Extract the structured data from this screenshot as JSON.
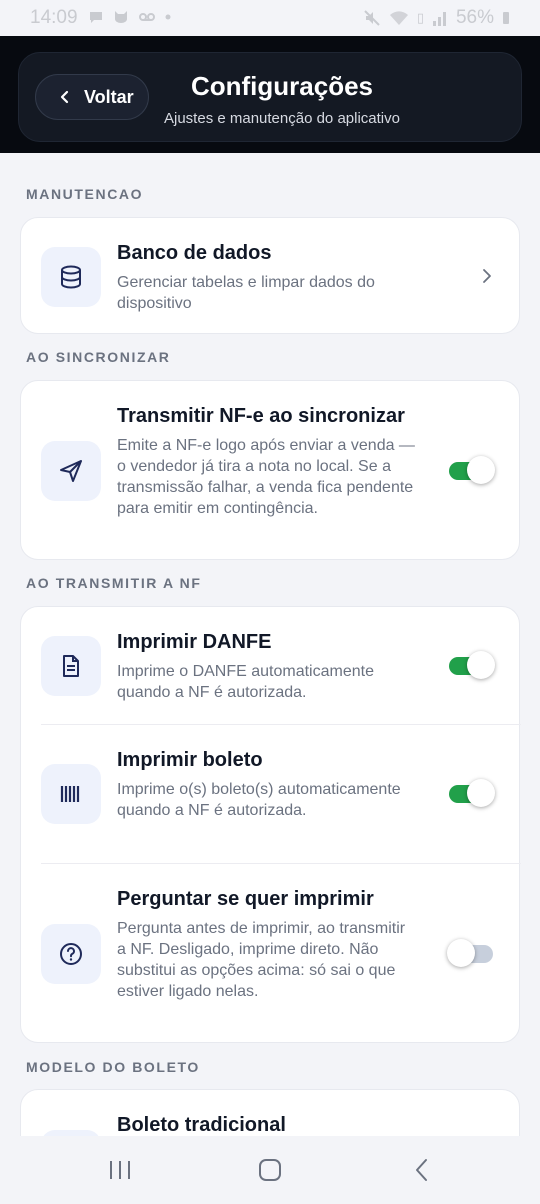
{
  "status_bar": {
    "time": "14:09",
    "left_icons": [
      "chat-bubble-icon",
      "cat-icon",
      "voicemail-icon",
      "dot-icon"
    ],
    "battery": "56%",
    "right_icons": [
      "mute-icon",
      "wifi-icon",
      "volte-icon",
      "signal-icon",
      "battery-icon"
    ]
  },
  "header": {
    "back_label": "Voltar",
    "title": "Configurações",
    "subtitle": "Ajustes e manutenção do aplicativo"
  },
  "sections": {
    "maintenance": {
      "label": "MANUTENCAO",
      "items": [
        {
          "title": "Banco de dados",
          "description": "Gerenciar tabelas e limpar dados do dispositivo",
          "icon": "database-icon"
        }
      ]
    },
    "on_sync": {
      "label": "AO SINCRONIZAR",
      "items": [
        {
          "title": "Transmitir NF-e ao sincronizar",
          "description": "Emite a NF-e logo após enviar a venda — o vendedor já tira a nota no local. Se a transmissão falhar, a venda fica pendente para emitir em contingência.",
          "icon": "send-icon",
          "enabled": true
        }
      ]
    },
    "on_transmit": {
      "label": "AO TRANSMITIR A NF",
      "items": [
        {
          "title": "Imprimir DANFE",
          "description": "Imprime o DANFE automaticamente quando a NF é autorizada.",
          "icon": "document-icon",
          "enabled": true
        },
        {
          "title": "Imprimir boleto",
          "description": "Imprime o(s) boleto(s) automaticamente quando a NF é autorizada.",
          "icon": "barcode-icon",
          "enabled": true
        },
        {
          "title": "Perguntar se quer imprimir",
          "description": "Pergunta antes de imprimir, ao transmitir a NF. Desligado, imprime direto. Não substitui as opções acima: só sai o que estiver ligado nelas.",
          "icon": "question-icon",
          "enabled": false
        }
      ]
    },
    "boleto_model": {
      "label": "MODELO DO BOLETO",
      "items": [
        {
          "title": "Boleto tradicional"
        }
      ]
    }
  },
  "colors": {
    "toggle_on": "#21a04a",
    "toggle_off": "#c7cfdc",
    "icon_bg": "#eef2fc",
    "icon_stroke": "#1f2a5a",
    "header_bg": "#141923"
  },
  "nav": {
    "icons": [
      "recent-apps-icon",
      "home-icon",
      "back-icon"
    ]
  }
}
